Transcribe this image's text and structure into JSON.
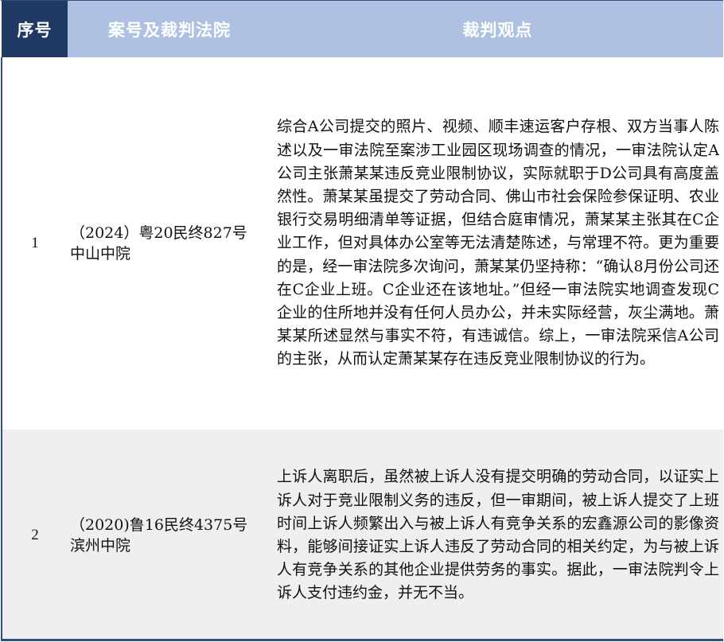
{
  "table": {
    "headers": {
      "num": "序号",
      "case": "案号及裁判法院",
      "view": "裁判观点"
    },
    "rows": [
      {
        "num": "1",
        "case": "（2024）粤20民终827号\n中山中院",
        "view": "综合A公司提交的照片、视频、顺丰速运客户存根、双方当事人陈述以及一审法院至案涉工业园区现场调查的情况，一审法院认定A公司主张萧某某违反竞业限制协议，实际就职于D公司具有高度盖然性。萧某某虽提交了劳动合同、佛山市社会保险参保证明、农业银行交易明细清单等证据，但结合庭审情况，萧某某主张其在C企业工作，但对具体办公室等无法清楚陈述，与常理不符。更为重要的是，经一审法院多次询问，萧某某仍坚持称：“确认8月份公司还在C企业上班。C企业还在该地址。”但经一审法院实地调查发现C企业的住所地并没有任何人员办公，并未实际经营，灰尘满地。萧某某所述显然与事实不符，有违诚信。综上，一审法院采信A公司的主张，从而认定萧某某存在违反竞业限制协议的行为。"
      },
      {
        "num": "2",
        "case": "（2020)鲁16民终4375号\n滨州中院",
        "view": "上诉人离职后，虽然被上诉人没有提交明确的劳动合同，以证实上诉人对于竞业限制义务的违反，但一审期间，被上诉人提交了上班时间上诉人频繁出入与被上诉人有竞争关系的宏鑫源公司的影像资料，能够间接证实上诉人违反了劳动合同的相关约定，为与被上诉人有竞争关系的其他企业提供劳务的事实。据此，一审法院判令上诉人支付违约金，并无不当。"
      }
    ]
  }
}
